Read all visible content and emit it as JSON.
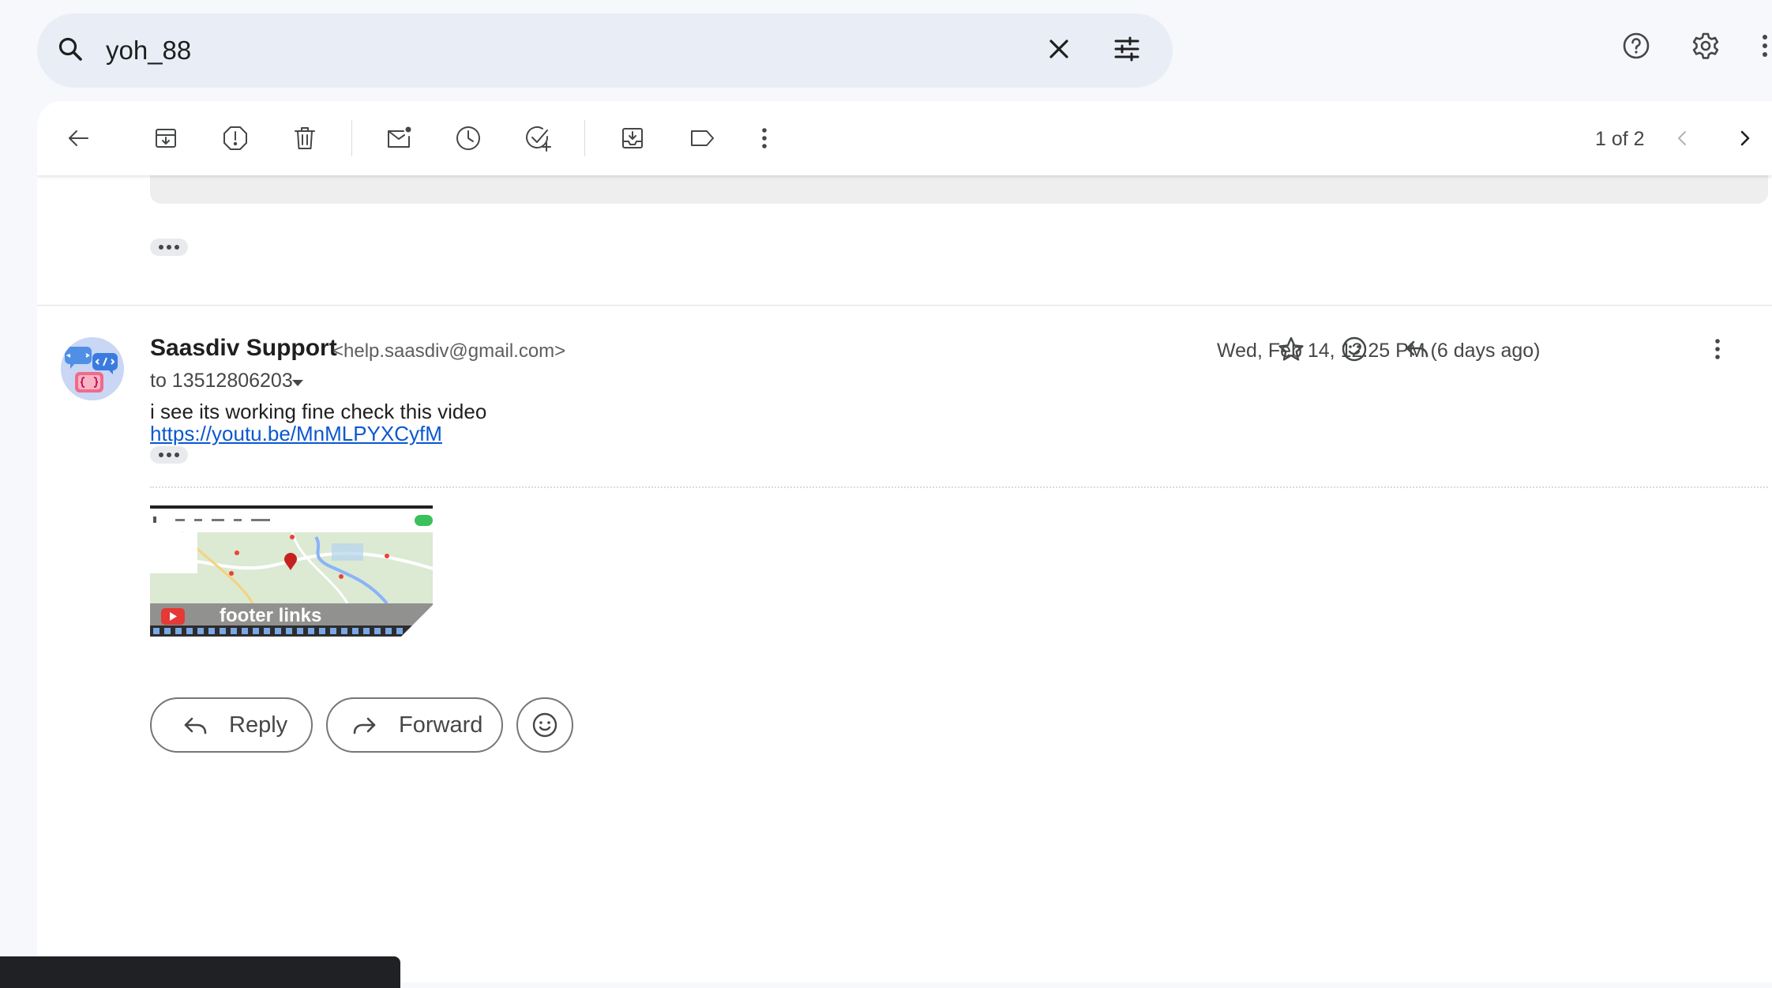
{
  "search": {
    "query": "yoh_88"
  },
  "toolbar": {
    "pager_text": "1 of 2"
  },
  "message": {
    "sender_name": "Saasdiv Support",
    "sender_email": "<help.saasdiv@gmail.com>",
    "recipient": "to 13512806203",
    "date": "Wed, Feb 14, 12:25 PM (6 days ago)",
    "body_text": "i see its working fine check this video",
    "link": "https://youtu.be/MnMLPYXCyfM",
    "video_title": "footer links"
  },
  "actions": {
    "reply_label": "Reply",
    "forward_label": "Forward"
  }
}
